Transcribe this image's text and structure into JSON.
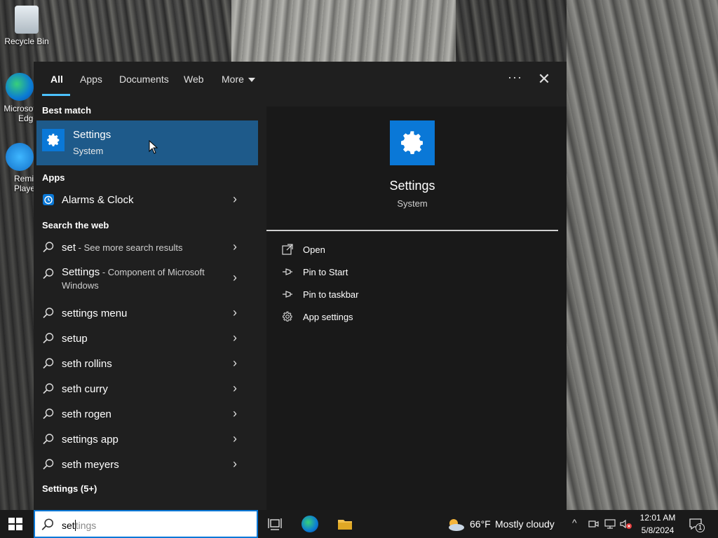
{
  "desktop": {
    "icons": [
      {
        "label": "Recycle Bin"
      },
      {
        "label": "Microsoft Edge"
      },
      {
        "label": "Remix Player"
      }
    ]
  },
  "tabs": {
    "items": [
      "All",
      "Apps",
      "Documents",
      "Web",
      "More"
    ],
    "active": "All",
    "more_options": "···",
    "close": "✕"
  },
  "results": {
    "best_match_header": "Best match",
    "best_match": {
      "title": "Settings",
      "subtitle": "System"
    },
    "apps_header": "Apps",
    "apps": [
      {
        "label": "Alarms & Clock"
      }
    ],
    "web_header": "Search the web",
    "web": [
      {
        "term": "set",
        "detail": " - See more search results"
      },
      {
        "term": "Settings",
        "detail": " - Component of Microsoft",
        "detail2": "Windows"
      },
      {
        "term": "settings menu",
        "detail": ""
      },
      {
        "term": "setup",
        "detail": ""
      },
      {
        "term": "seth rollins",
        "detail": ""
      },
      {
        "term": "seth curry",
        "detail": ""
      },
      {
        "term": "seth rogen",
        "detail": ""
      },
      {
        "term": "settings app",
        "detail": ""
      },
      {
        "term": "seth meyers",
        "detail": ""
      }
    ],
    "settings_footer": "Settings (5+)"
  },
  "preview": {
    "title": "Settings",
    "subtitle": "System",
    "actions": [
      {
        "label": "Open",
        "icon": "open-icon"
      },
      {
        "label": "Pin to Start",
        "icon": "pin-icon"
      },
      {
        "label": "Pin to taskbar",
        "icon": "pin-icon"
      },
      {
        "label": "App settings",
        "icon": "gear-icon"
      }
    ]
  },
  "taskbar": {
    "search_typed": "set",
    "search_ghost": "tings",
    "weather_temp": "66°F",
    "weather_condition": "Mostly cloudy",
    "time": "12:01 AM",
    "date": "5/8/2024",
    "notification_count": "1"
  },
  "colors": {
    "accent": "#0a78d7",
    "highlight": "#1e5a8a",
    "underline": "#4cc2ff"
  }
}
